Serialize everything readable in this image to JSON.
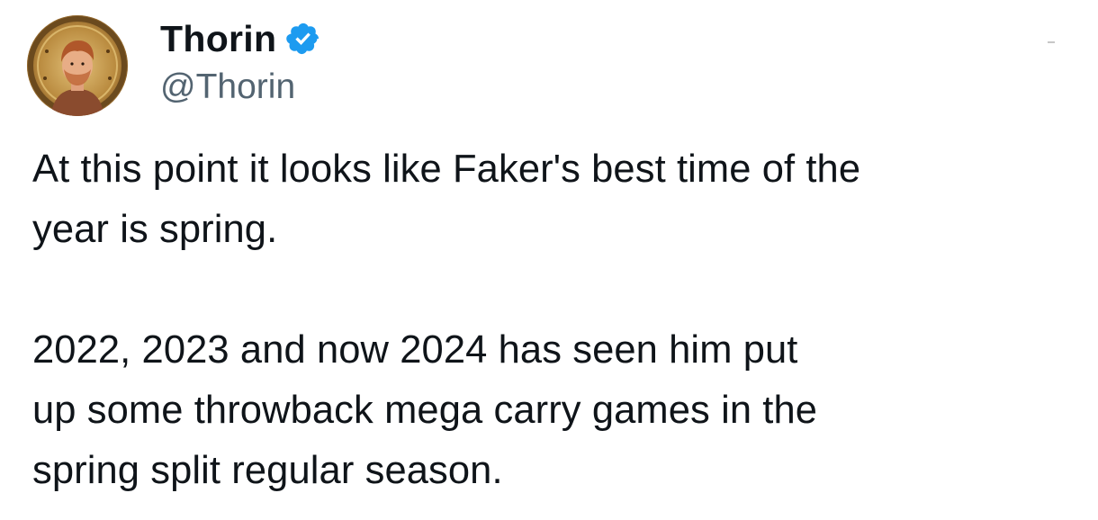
{
  "author": {
    "display_name": "Thorin",
    "handle": "@Thorin",
    "verified": true,
    "verified_color": "#1d9bf0",
    "avatar_icon": "avatar-portrait"
  },
  "tweet": {
    "paragraphs": [
      "At this point it looks like Faker's best time of the\nyear is spring.",
      "2022, 2023 and now 2024 has seen him put\nup some throwback mega carry games in the\nspring split regular season."
    ]
  }
}
